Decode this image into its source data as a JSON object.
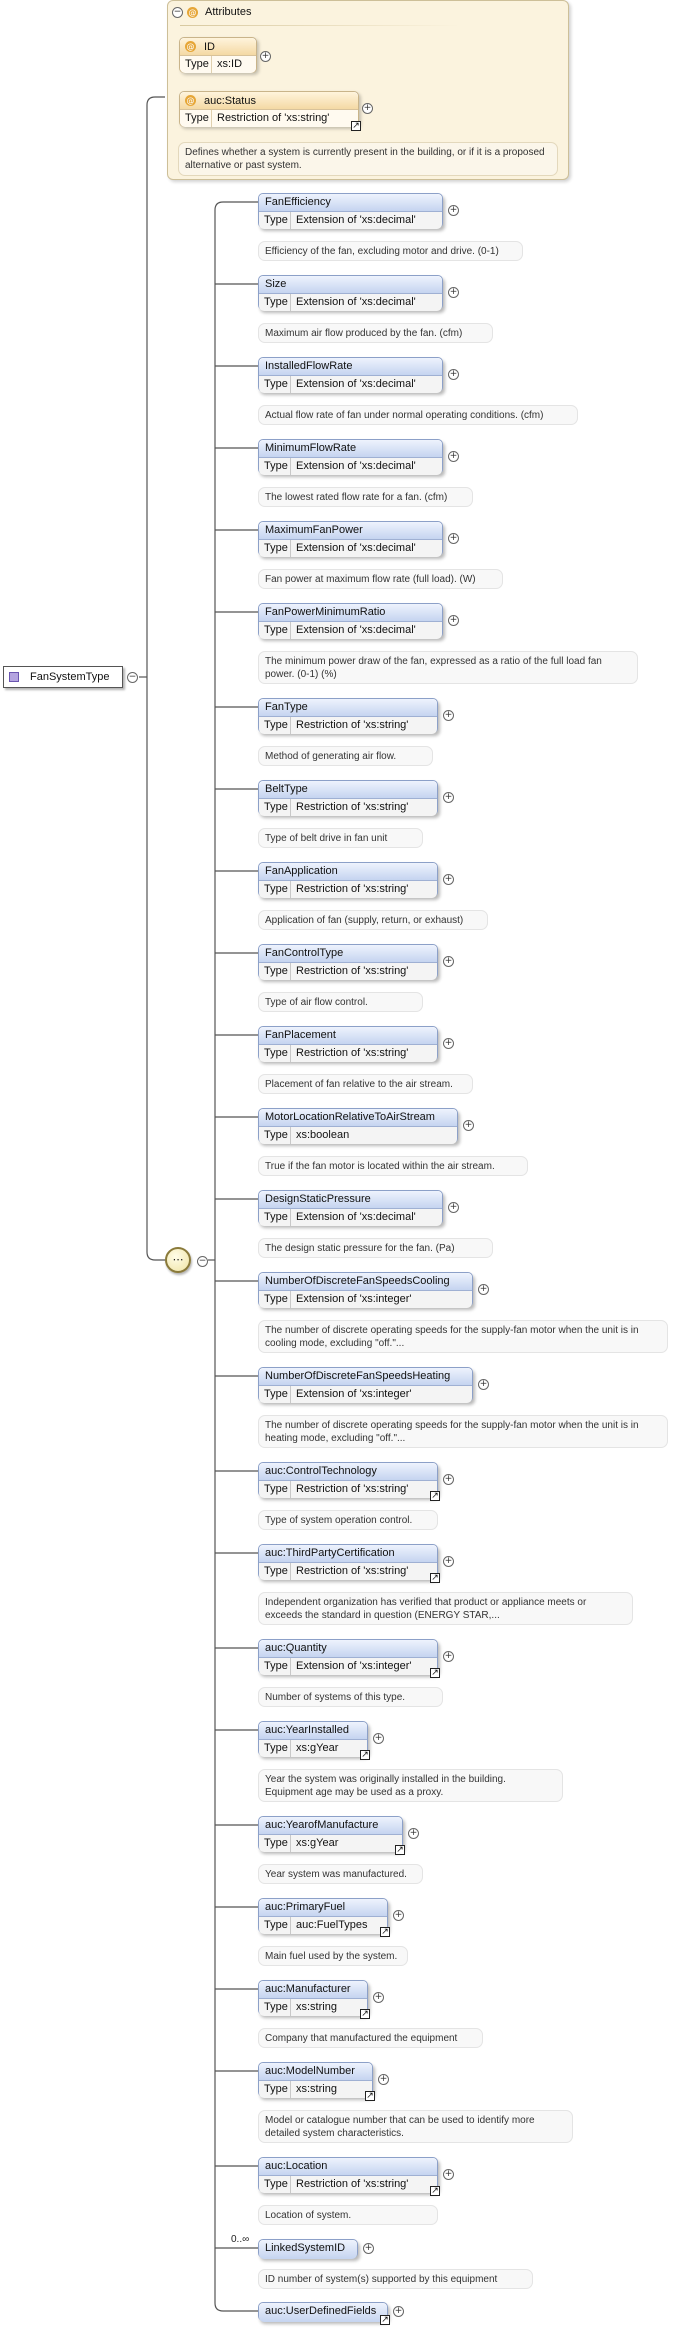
{
  "root": {
    "name": "FanSystemType",
    "expander": "−"
  },
  "attributes": {
    "title": "Attributes",
    "type_label": "Type",
    "items": [
      {
        "name": "ID",
        "type": "xs:ID"
      },
      {
        "name": "auc:Status",
        "type": "Restriction of 'xs:string'"
      }
    ],
    "status_doc": "Defines whether a system is currently present in the building, or if it is a proposed alternative or past system."
  },
  "sequence": {
    "icon": "sequence-compositor-icon",
    "occurrence": "0..∞"
  },
  "type_label": "Type",
  "elements": [
    {
      "name": "FanEfficiency",
      "type": "Extension of 'xs:decimal'",
      "doc": "Efficiency of the fan, excluding motor and drive. (0-1)"
    },
    {
      "name": "Size",
      "type": "Extension of 'xs:decimal'",
      "doc": "Maximum air flow produced by the fan. (cfm)"
    },
    {
      "name": "InstalledFlowRate",
      "type": "Extension of 'xs:decimal'",
      "doc": "Actual flow rate of fan under normal operating conditions. (cfm)"
    },
    {
      "name": "MinimumFlowRate",
      "type": "Extension of 'xs:decimal'",
      "doc": "The lowest rated flow rate for a fan. (cfm)"
    },
    {
      "name": "MaximumFanPower",
      "type": "Extension of 'xs:decimal'",
      "doc": "Fan power at maximum flow rate (full load). (W)"
    },
    {
      "name": "FanPowerMinimumRatio",
      "type": "Extension of 'xs:decimal'",
      "doc": "The minimum power draw of the fan, expressed as a ratio of the full load fan power. (0-1) (%)"
    },
    {
      "name": "FanType",
      "type": "Restriction of 'xs:string'",
      "doc": "Method of generating air flow."
    },
    {
      "name": "BeltType",
      "type": "Restriction of 'xs:string'",
      "doc": "Type of belt drive in fan unit"
    },
    {
      "name": "FanApplication",
      "type": "Restriction of 'xs:string'",
      "doc": "Application of fan (supply, return, or exhaust)"
    },
    {
      "name": "FanControlType",
      "type": "Restriction of 'xs:string'",
      "doc": "Type of air flow control."
    },
    {
      "name": "FanPlacement",
      "type": "Restriction of 'xs:string'",
      "doc": "Placement of fan relative to the air stream."
    },
    {
      "name": "MotorLocationRelativeToAirStream",
      "type": "xs:boolean",
      "doc": "True if the fan motor is located within the air stream."
    },
    {
      "name": "DesignStaticPressure",
      "type": "Extension of 'xs:decimal'",
      "doc": "The design static pressure for the fan. (Pa)"
    },
    {
      "name": "NumberOfDiscreteFanSpeedsCooling",
      "type": "Extension of 'xs:integer'",
      "doc": "The number of discrete operating speeds for the supply-fan motor when the unit is in cooling mode, excluding \"off.\"..."
    },
    {
      "name": "NumberOfDiscreteFanSpeedsHeating",
      "type": "Extension of 'xs:integer'",
      "doc": "The number of discrete operating speeds for the supply-fan motor when the unit is in heating mode, excluding \"off.\"..."
    },
    {
      "name": "auc:ControlTechnology",
      "type": "Restriction of 'xs:string'",
      "doc": "Type of system operation control."
    },
    {
      "name": "auc:ThirdPartyCertification",
      "type": "Restriction of 'xs:string'",
      "doc": "Independent organization has verified that product or appliance meets or exceeds the standard in question (ENERGY STAR,..."
    },
    {
      "name": "auc:Quantity",
      "type": "Extension of 'xs:integer'",
      "doc": "Number of systems of this type."
    },
    {
      "name": "auc:YearInstalled",
      "type": "xs:gYear",
      "doc": "Year the system was originally installed in the building. Equipment age may be used as a proxy."
    },
    {
      "name": "auc:YearofManufacture",
      "type": "xs:gYear",
      "doc": "Year system was manufactured."
    },
    {
      "name": "auc:PrimaryFuel",
      "type": "auc:FuelTypes",
      "doc": "Main fuel used by the system."
    },
    {
      "name": "auc:Manufacturer",
      "type": "xs:string",
      "doc": "Company that manufactured the equipment"
    },
    {
      "name": "auc:ModelNumber",
      "type": "xs:string",
      "doc": "Model or catalogue number that can be used to identify more detailed system characteristics."
    },
    {
      "name": "auc:Location",
      "type": "Restriction of 'xs:string'",
      "doc": "Location of system."
    },
    {
      "name": "LinkedSystemID",
      "type": "",
      "doc": "ID number of system(s) supported by this equipment"
    },
    {
      "name": "auc:UserDefinedFields",
      "type": "",
      "doc": ""
    }
  ]
}
